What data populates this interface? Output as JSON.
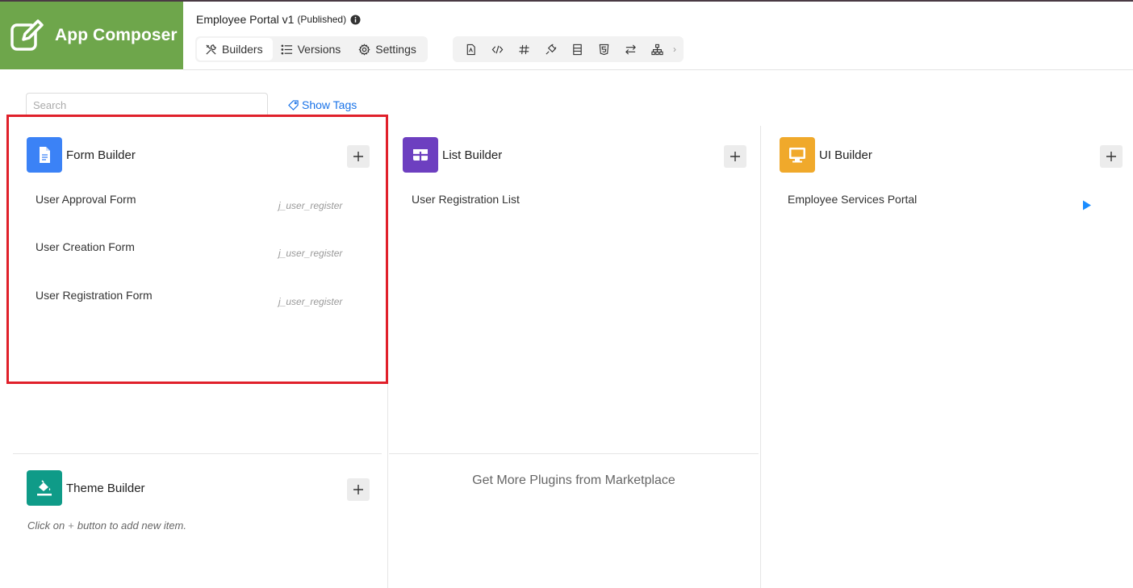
{
  "app": {
    "title": "App Composer",
    "accent_color": "#6ea64b"
  },
  "header": {
    "portal_name": "Employee Portal v1",
    "portal_status": "(Published)",
    "tabs": [
      {
        "label": "Builders",
        "icon": "tools-icon",
        "active": true
      },
      {
        "label": "Versions",
        "icon": "list-icon",
        "active": false
      },
      {
        "label": "Settings",
        "icon": "gear-icon",
        "active": false
      }
    ],
    "tools": [
      "file-icon",
      "code-icon",
      "hash-icon",
      "plug-icon",
      "panel-icon",
      "html-icon",
      "arrows-swap-icon",
      "sitemap-icon"
    ]
  },
  "search": {
    "placeholder": "Search",
    "value": ""
  },
  "show_tags_label": "Show Tags",
  "builders": {
    "form": {
      "title": "Form Builder",
      "color": "#3b82f6",
      "items": [
        {
          "label": "User Approval Form",
          "tag": "j_user_register"
        },
        {
          "label": "User Creation Form",
          "tag": "j_user_register"
        },
        {
          "label": "User Registration Form",
          "tag": "j_user_register"
        }
      ]
    },
    "list": {
      "title": "List Builder",
      "color": "#6d3fc0",
      "items": [
        {
          "label": "User Registration List"
        }
      ]
    },
    "ui": {
      "title": "UI Builder",
      "color": "#f0a92b",
      "items": [
        {
          "label": "Employee Services Portal"
        }
      ]
    },
    "theme": {
      "title": "Theme Builder",
      "color": "#0f9b88",
      "hint_before": "Click on",
      "hint_plus": "+",
      "hint_after": "button to add new item."
    }
  },
  "marketplace_label": "Get More Plugins from Marketplace"
}
